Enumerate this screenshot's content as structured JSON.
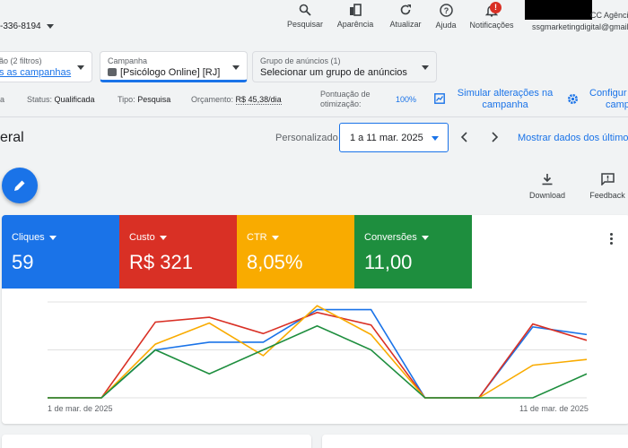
{
  "header": {
    "account_id": "-336-8194",
    "tools": [
      {
        "label": "Pesquisar",
        "icon": "search-icon"
      },
      {
        "label": "Aparência",
        "icon": "appearance-icon"
      },
      {
        "label": "Atualizar",
        "icon": "refresh-icon"
      },
      {
        "label": "Ajuda",
        "icon": "help-icon"
      },
      {
        "label": "Notificações",
        "icon": "bell-icon"
      }
    ],
    "notification_badge": "!",
    "account_name": "CC Agênci",
    "account_email": "ssgmarketingdigital@gmail"
  },
  "filters": {
    "view": {
      "label": "ão (2 filtros)",
      "value": "s as campanhas"
    },
    "campaign": {
      "label": "Campanha",
      "value": "[Psicólogo Online] [RJ]"
    },
    "ad_group": {
      "label": "Grupo de anúncios (1)",
      "value": "Selecionar um grupo de anúncios"
    }
  },
  "status_row": {
    "lead": "a",
    "status_label": "Status:",
    "status_value": "Qualificada",
    "type_label": "Tipo:",
    "type_value": "Pesquisa",
    "budget_label": "Orçamento:",
    "budget_value": "R$ 45,38/dia",
    "opt_label_1": "Pontuação de",
    "opt_label_2": "otimização:",
    "opt_value": "100%",
    "simulate_1": "Simular alterações na",
    "simulate_2": "campanha",
    "configure_1": "Configur",
    "configure_2": "camp"
  },
  "overview": {
    "title": "eral",
    "date_mode": "Personalizado",
    "date_range": "1 a 11 mar. 2025",
    "show_last": "Mostrar dados dos últimos",
    "download_label": "Download",
    "feedback_label": "Feedback"
  },
  "metrics": [
    {
      "label": "Cliques",
      "value": "59",
      "color": "#1a73e8"
    },
    {
      "label": "Custo",
      "value": "R$ 321",
      "color": "#d93025"
    },
    {
      "label": "CTR",
      "value": "8,05%",
      "color": "#f9ab00"
    },
    {
      "label": "Conversões",
      "value": "11,00",
      "color": "#1e8e3e"
    }
  ],
  "chart_data": {
    "type": "line",
    "x": [
      "1 mar.",
      "2 mar.",
      "3 mar.",
      "4 mar.",
      "5 mar.",
      "6 mar.",
      "7 mar.",
      "8 mar.",
      "9 mar.",
      "10 mar.",
      "11 mar."
    ],
    "x_tick_labels": [
      "1 de mar. de 2025",
      "11 de mar. de 2025"
    ],
    "grid": true,
    "series": [
      {
        "name": "Cliques",
        "color": "#1a73e8",
        "values": [
          0,
          0,
          0.5,
          0.58,
          0.58,
          0.92,
          0.92,
          0,
          0,
          0.74,
          0.66
        ]
      },
      {
        "name": "Custo",
        "color": "#d93025",
        "values": [
          0,
          0,
          0.79,
          0.84,
          0.67,
          0.89,
          0.76,
          0,
          0,
          0.77,
          0.6
        ]
      },
      {
        "name": "CTR",
        "color": "#f9ab00",
        "values": [
          0,
          0,
          0.56,
          0.78,
          0.44,
          0.96,
          0.66,
          0,
          0,
          0.34,
          0.4
        ]
      },
      {
        "name": "Conversões",
        "color": "#1e8e3e",
        "values": [
          0,
          0,
          0.5,
          0.25,
          0.5,
          0.75,
          0.5,
          0,
          0,
          0,
          0.25
        ]
      }
    ]
  }
}
